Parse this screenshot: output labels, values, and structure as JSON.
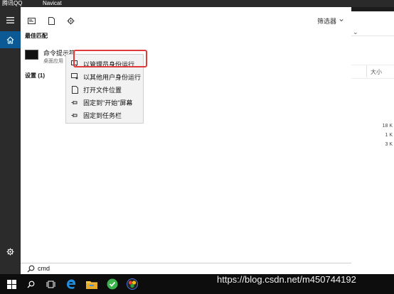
{
  "desktop": {
    "items": [
      "腾讯QQ",
      "Navicat"
    ]
  },
  "search_panel": {
    "toolbar": {
      "filter_label": "筛选器",
      "icons": [
        "document-list-icon",
        "document-icon",
        "gear-icon"
      ]
    },
    "best_match_heading": "最佳匹配",
    "best_match": {
      "title": "命令提示符",
      "subtitle": "桌面应用",
      "icon": "terminal-icon"
    },
    "settings_heading": "设置 (1)"
  },
  "context_menu": {
    "items": [
      {
        "label": "以管理员身份运行",
        "icon": "admin-run-icon"
      },
      {
        "label": "以其他用户身份运行",
        "icon": "other-user-run-icon"
      },
      {
        "label": "打开文件位置",
        "icon": "file-location-icon"
      },
      {
        "label": "固定到\"开始\"屏幕",
        "icon": "pin-icon"
      },
      {
        "label": "固定到任务栏",
        "icon": "pin-icon"
      }
    ],
    "highlighted_index": 0,
    "highlight_color": "#e03a3a"
  },
  "search_box": {
    "value": "cmd",
    "icon": "search-icon"
  },
  "rail": {
    "icons": [
      "hamburger-icon",
      "home-icon",
      "gear-icon"
    ],
    "active": "home-icon",
    "accent": "#0b5a95"
  },
  "background_window": {
    "column_header": "大小",
    "values": [
      "18 K",
      "1 K",
      "3 K"
    ]
  },
  "taskbar": {
    "icons": [
      "windows-start-icon",
      "search-icon",
      "task-view-icon",
      "edge-icon",
      "file-explorer-icon",
      "browser-green-icon",
      "colorful-app-icon"
    ]
  },
  "watermark": "https://blog.csdn.net/m450744192"
}
